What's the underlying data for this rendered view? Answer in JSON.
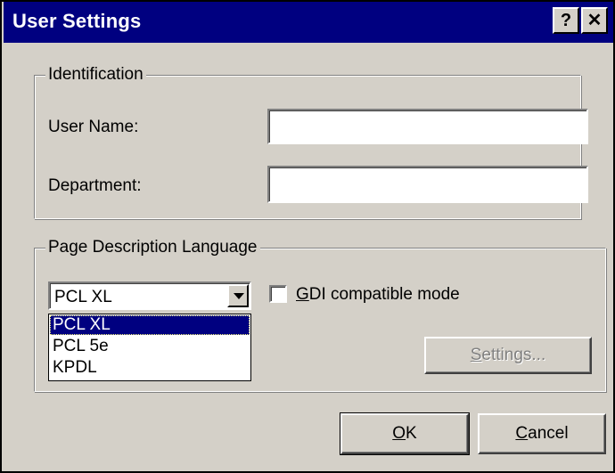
{
  "window": {
    "title": "User Settings",
    "help_button": "?",
    "close_button": "✕"
  },
  "identification": {
    "legend": "Identification",
    "user_name_label": "User Name:",
    "user_name_value": "",
    "department_label": "Department:",
    "department_value": ""
  },
  "pdl": {
    "legend": "Page Description Language",
    "selected": "PCL XL",
    "options": [
      "PCL XL",
      "PCL 5e",
      "KPDL"
    ],
    "gdi_label": "GDI compatible mode",
    "gdi_mnemonic": "G",
    "gdi_rest": "DI compatible mode",
    "gdi_checked": false,
    "settings_label": "Settings...",
    "settings_mnemonic": "S",
    "settings_rest": "ettings..."
  },
  "buttons": {
    "ok_mnemonic": "O",
    "ok_rest": "K",
    "cancel_mnemonic": "C",
    "cancel_rest": "ancel"
  },
  "colors": {
    "titlebar": "#000080",
    "face": "#d4d0c8",
    "selection": "#000080"
  }
}
